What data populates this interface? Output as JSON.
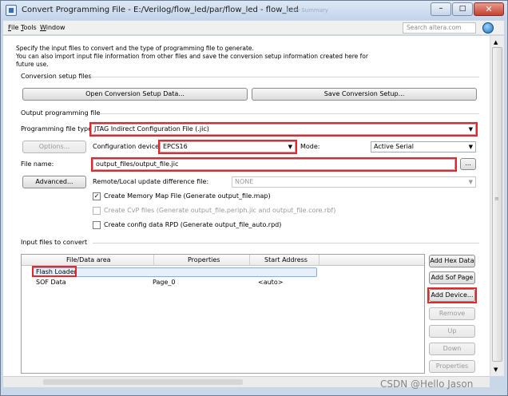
{
  "window": {
    "title": "Convert Programming File - E:/Verilog/flow_led/par/flow_led - flow_led",
    "title_bg_ghost": "Flow Summary"
  },
  "menu": {
    "items": [
      {
        "key": "F",
        "rest": "ile"
      },
      {
        "key": "T",
        "rest": "ools"
      },
      {
        "key": "W",
        "rest": "indow"
      }
    ],
    "search_placeholder": "Search altera.com"
  },
  "intro": {
    "line1": "Specify the input files to convert and the type of programming file to generate.",
    "line2": "You can also import input file information from other files and save the conversion setup information created here for",
    "line3": "future use."
  },
  "conversion_setup": {
    "heading": "Conversion setup files",
    "open_button": "Open Conversion Setup Data...",
    "save_button": "Save Conversion Setup..."
  },
  "output": {
    "heading": "Output programming file",
    "file_type_label": "Programming file type:",
    "file_type_value": "JTAG Indirect Configuration File (.jic)",
    "options_button": "Options...",
    "config_device_label": "Configuration device:",
    "config_device_value": "EPCS16",
    "mode_label": "Mode:",
    "mode_value": "Active Serial",
    "file_name_label": "File name:",
    "file_name_value": "output_files/output_file.jic",
    "browse_button": "...",
    "advanced_button": "Advanced...",
    "remote_label": "Remote/Local update difference file:",
    "remote_value": "NONE",
    "check_map": "Create Memory Map File (Generate output_file.map)",
    "check_cvp": "Create CvP files (Generate output_file.periph.jic and output_file.core.rbf)",
    "check_rpd": "Create config data RPD (Generate output_file_auto.rpd)"
  },
  "input": {
    "heading": "Input files to convert",
    "columns": [
      "File/Data area",
      "Properties",
      "Start Address"
    ],
    "rows": [
      {
        "name": "Flash Loader",
        "props": "",
        "addr": ""
      },
      {
        "name": "SOF Data",
        "props": "Page_0",
        "addr": "<auto>"
      }
    ],
    "buttons": {
      "add_hex": "Add Hex Data",
      "add_sof": "Add Sof Page",
      "add_device": "Add Device...",
      "remove": "Remove",
      "up": "Up",
      "down": "Down",
      "properties": "Properties"
    }
  },
  "watermark": "CSDN @Hello Jason"
}
